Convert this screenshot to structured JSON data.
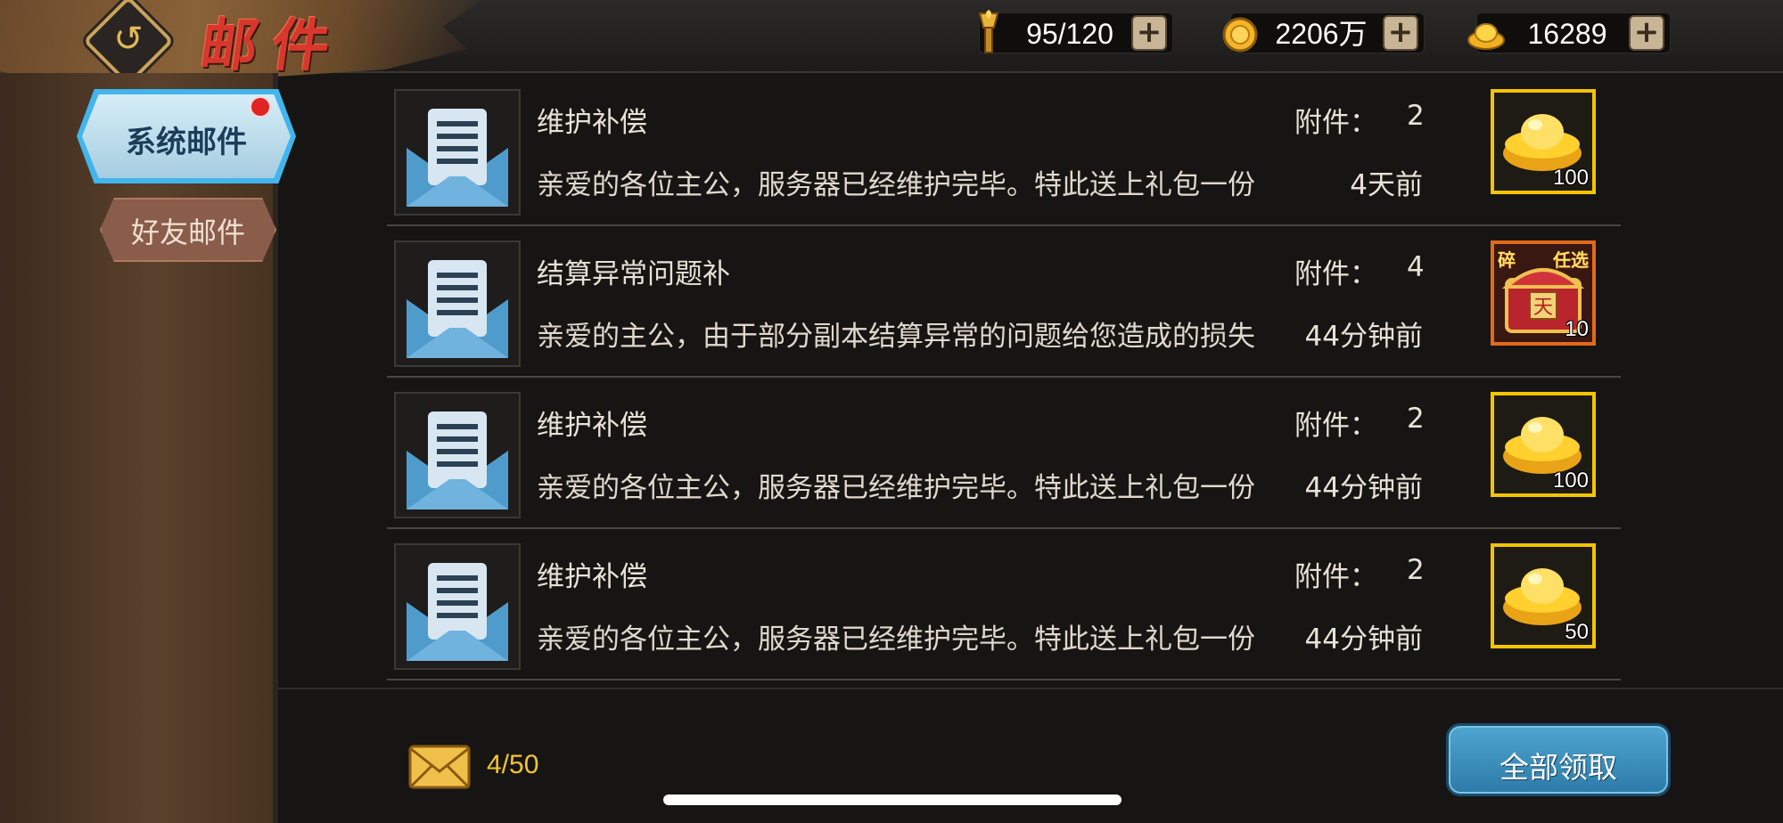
{
  "header": {
    "title": "邮件",
    "resources": [
      {
        "icon": "torch-stamina-icon",
        "value": "95/120"
      },
      {
        "icon": "gold-coin-icon",
        "value": "2206万"
      },
      {
        "icon": "ingot-icon",
        "value": "16289"
      }
    ]
  },
  "sidebar": {
    "tabs": [
      {
        "label": "系统邮件",
        "active": true,
        "has_notification": true
      },
      {
        "label": "好友邮件",
        "active": false,
        "has_notification": false
      }
    ]
  },
  "mails": [
    {
      "title": "维护补偿",
      "message": "亲爱的各位主公，服务器已经维护完毕。特此送上礼包一份",
      "attach_label": "附件：",
      "attach_count": "2",
      "time": "4天前",
      "item": {
        "icon": "gold-ingot-icon",
        "qty": "100"
      }
    },
    {
      "title": "结算异常问题补",
      "message": "亲爱的主公，由于部分副本结算异常的问题给您造成的损失",
      "attach_label": "附件：",
      "attach_count": "4",
      "time": "44分钟前",
      "item": {
        "icon": "treasure-chest-icon",
        "qty": "10",
        "corner_left": "碎",
        "corner_right": "任选"
      }
    },
    {
      "title": "维护补偿",
      "message": "亲爱的各位主公，服务器已经维护完毕。特此送上礼包一份",
      "attach_label": "附件：",
      "attach_count": "2",
      "time": "44分钟前",
      "item": {
        "icon": "gold-ingot-icon",
        "qty": "100"
      }
    },
    {
      "title": "维护补偿",
      "message": "亲爱的各位主公，服务器已经维护完毕。特此送上礼包一份",
      "attach_label": "附件：",
      "attach_count": "2",
      "time": "44分钟前",
      "item": {
        "icon": "gold-ingot-icon",
        "qty": "50"
      }
    }
  ],
  "footer": {
    "mail_count": "4/50",
    "claim_all_label": "全部领取"
  },
  "colors": {
    "accent_blue": "#41b5ec",
    "item_border_gold": "#f4c400",
    "item_border_orange": "#e26a1a",
    "count_yellow": "#f4c430"
  }
}
